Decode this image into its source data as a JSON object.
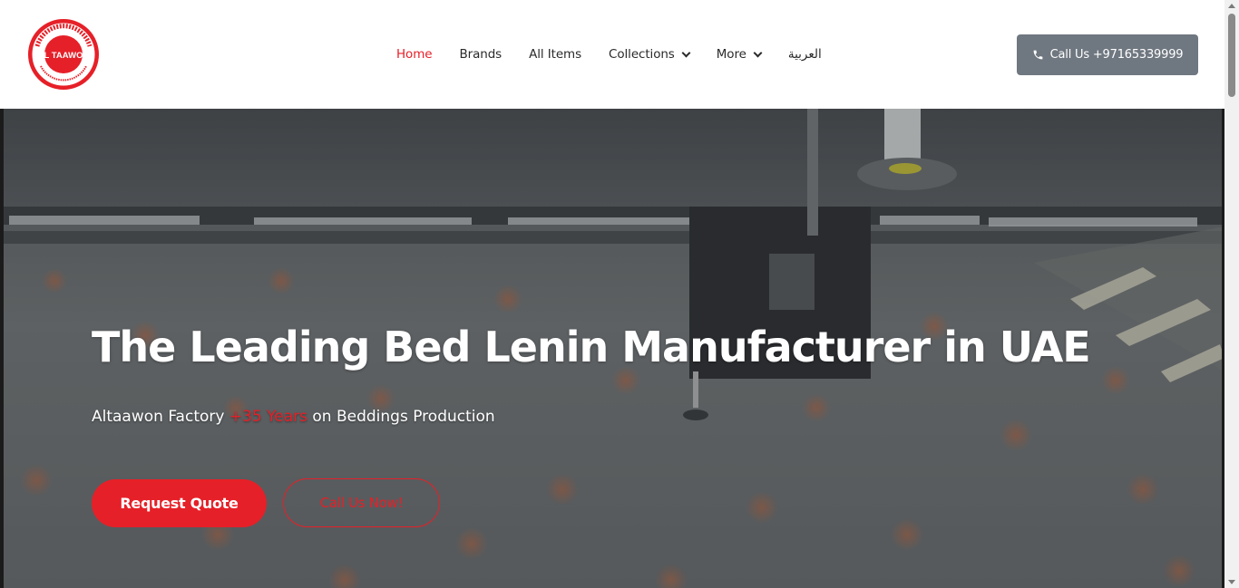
{
  "logo": {
    "text": "AL TAAWON",
    "arabic_arc": "مصنع التعاون للبوليستر و منتجاته",
    "english_arc": "AL TAAWON POLYESTER & PRODUCTS",
    "color": "#e62028"
  },
  "nav": {
    "items": [
      {
        "label": "Home",
        "active": true
      },
      {
        "label": "Brands"
      },
      {
        "label": "All Items"
      },
      {
        "label": "Collections",
        "dropdown": true
      },
      {
        "label": "More",
        "dropdown": true
      },
      {
        "label": "العربية"
      }
    ]
  },
  "header": {
    "call_label": "Call Us +97165339999",
    "call_icon": "phone-icon"
  },
  "hero": {
    "title": "The Leading Bed Lenin Manufacturer in UAE",
    "subtitle_before": "Altaawon Factory ",
    "subtitle_highlight": "+35 Years",
    "subtitle_after": " on Beddings Production",
    "primary_button": "Request Quote",
    "secondary_button": "Call Us Now!"
  },
  "colors": {
    "accent": "#e62028",
    "call_button": "#6f7780"
  }
}
